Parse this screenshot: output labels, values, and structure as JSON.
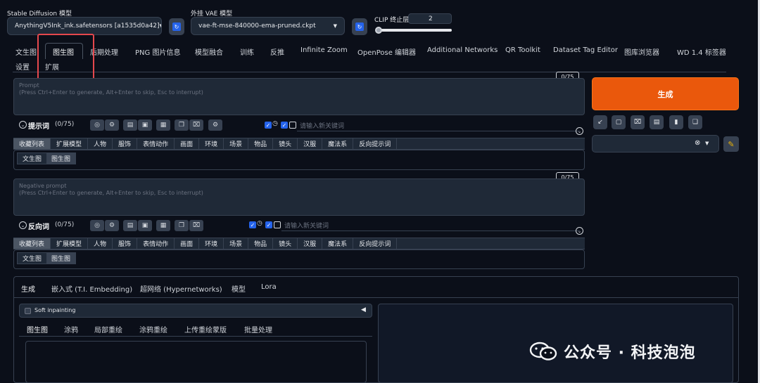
{
  "model": {
    "checkpoint_label": "Stable Diffusion 模型",
    "checkpoint_value": "AnythingV5Ink_ink.safetensors [a1535d0a42]",
    "vae_label": "外挂 VAE 模型",
    "vae_value": "vae-ft-mse-840000-ema-pruned.ckpt",
    "clip_label": "CLIP 终止层数",
    "clip_value": "2"
  },
  "tabs": [
    "文生图",
    "图生图",
    "后期处理",
    "PNG 图片信息",
    "模型融合",
    "训练",
    "反推",
    "Infinite Zoom",
    "OpenPose 编辑器",
    "Additional Networks",
    "QR Toolkit",
    "Dataset Tag Editor",
    "图库浏览器",
    "WD 1.4 标签器",
    "设置",
    "扩展"
  ],
  "active_tab": "图生图",
  "prompt": {
    "placeholder_line1": "Prompt",
    "placeholder_line2": "(Press Ctrl+Enter to generate, Alt+Enter to skip, Esc to interrupt)",
    "counter": "0/75",
    "section_label": "提示词",
    "section_count": "(0/75)",
    "keyword_placeholder": "请输入新关键词"
  },
  "negative": {
    "placeholder_line1": "Negative prompt",
    "placeholder_line2": "(Press Ctrl+Enter to generate, Alt+Enter to skip, Esc to interrupt)",
    "counter": "0/75",
    "section_label": "反向词",
    "section_count": "(0/75)",
    "keyword_placeholder": "请输入新关键词"
  },
  "categories": [
    "收藏列表",
    "扩展模型",
    "人物",
    "服饰",
    "表情动作",
    "画面",
    "环境",
    "场景",
    "物品",
    "镜头",
    "汉服",
    "魔法系",
    "反向提示词"
  ],
  "sub_tabs": [
    "文生图",
    "图生图"
  ],
  "generate_label": "生成",
  "lower_tabs": [
    "生成",
    "嵌入式 (T.I. Embedding)",
    "超网络 (Hypernetworks)",
    "模型",
    "Lora"
  ],
  "soft_inpainting_label": "Soft inpainting",
  "img2img_tabs": [
    "图生图",
    "涂鸦",
    "局部重绘",
    "涂鸦重绘",
    "上传重绘蒙版",
    "批量处理"
  ],
  "watermark": "公众号 · 科技泡泡",
  "colors": {
    "accent": "#ea580c",
    "highlight": "#e5484d",
    "checkbox": "#2563eb",
    "background": "#0b0f19"
  }
}
